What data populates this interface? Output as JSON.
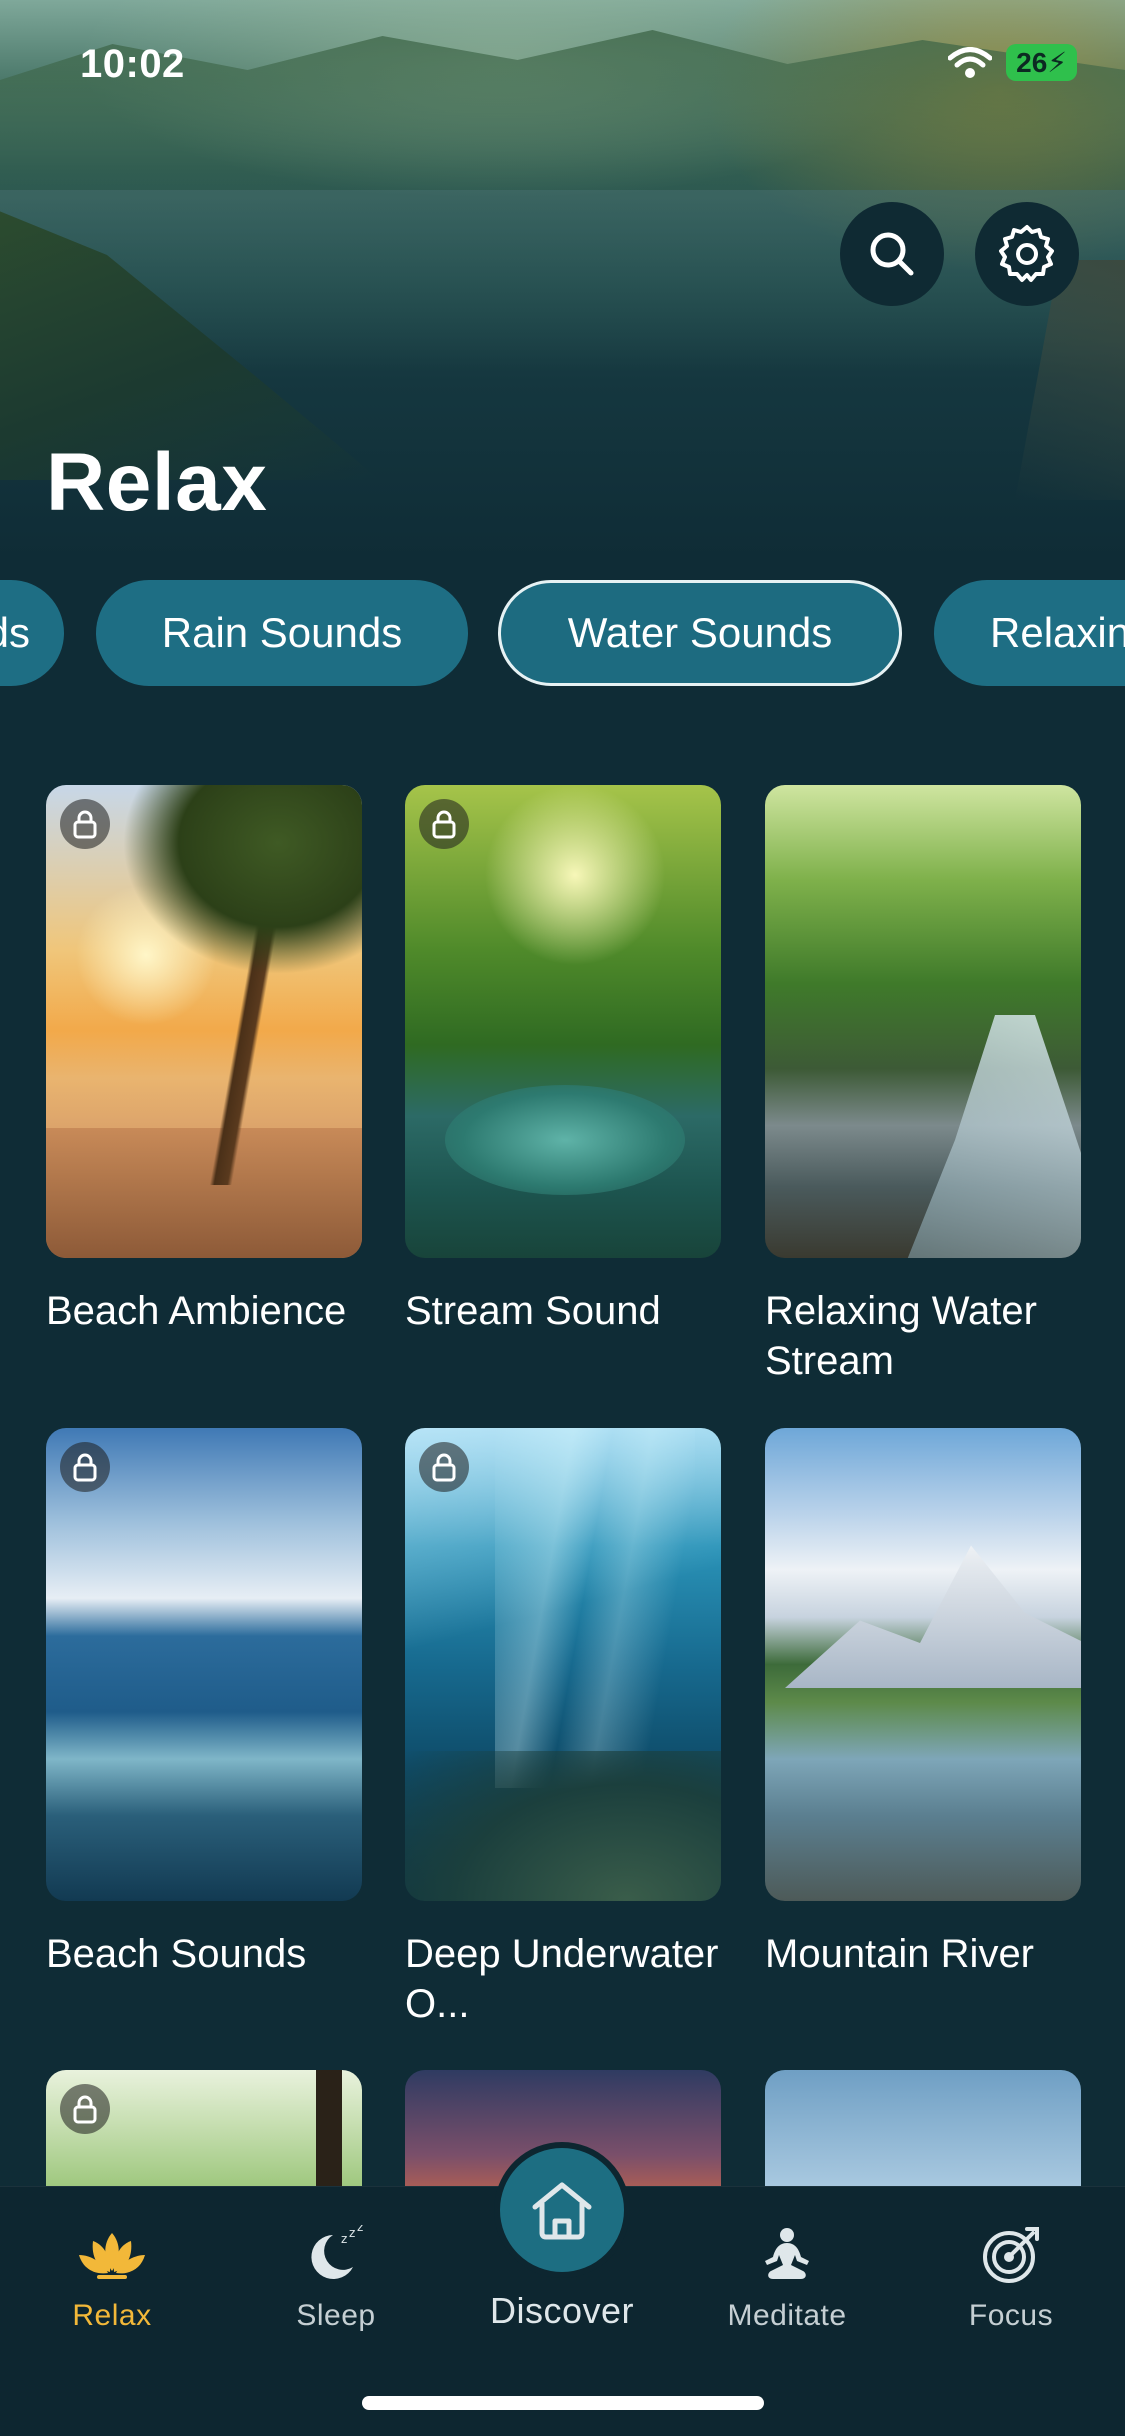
{
  "status_bar": {
    "time": "10:02",
    "battery": "26"
  },
  "header": {
    "title": "Relax"
  },
  "categories": [
    {
      "label": "Sounds",
      "selected": false
    },
    {
      "label": "Rain Sounds",
      "selected": false
    },
    {
      "label": "Water Sounds",
      "selected": true
    },
    {
      "label": "Relaxing",
      "selected": false
    }
  ],
  "sounds": [
    {
      "title": "Beach Ambience",
      "locked": true
    },
    {
      "title": "Stream Sound",
      "locked": true
    },
    {
      "title": "Relaxing Water Stream",
      "locked": false
    },
    {
      "title": "Beach Sounds",
      "locked": true
    },
    {
      "title": "Deep Underwater O...",
      "locked": true
    },
    {
      "title": "Mountain River",
      "locked": false
    },
    {
      "title": "",
      "locked": true
    },
    {
      "title": "",
      "locked": false
    },
    {
      "title": "",
      "locked": false
    }
  ],
  "tabs": {
    "relax": "Relax",
    "sleep": "Sleep",
    "discover": "Discover",
    "meditate": "Meditate",
    "focus": "Focus"
  },
  "colors": {
    "accent": "#f2b839",
    "chip": "#1e6e84",
    "background": "#0f2c36"
  }
}
